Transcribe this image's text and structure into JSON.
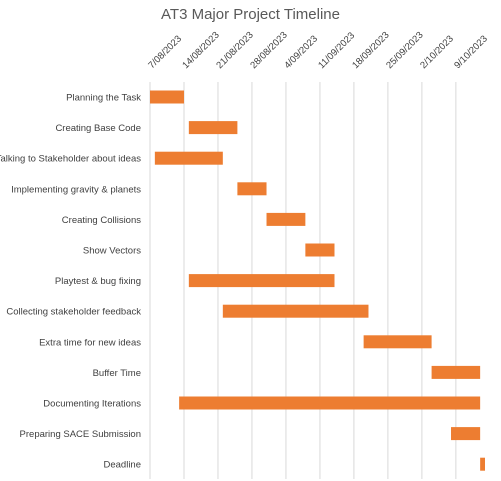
{
  "chart_data": {
    "type": "bar",
    "title": "AT3 Major Project Timeline",
    "x_ticks": [
      "7/08/2023",
      "14/08/2023",
      "21/08/2023",
      "28/08/2023",
      "4/09/2023",
      "11/09/2023",
      "18/09/2023",
      "25/09/2023",
      "2/10/2023",
      "9/10/2023"
    ],
    "xlim": [
      "2023-08-07",
      "2023-10-15"
    ],
    "grid": "vertical",
    "bar_color": "#ED7D31",
    "grid_color": "#D9D9D9",
    "tasks": [
      {
        "name": "Planning the Task",
        "start": "2023-08-07",
        "end": "2023-08-14"
      },
      {
        "name": "Creating Base Code",
        "start": "2023-08-15",
        "end": "2023-08-25"
      },
      {
        "name": "Talking to Stakeholder about ideas",
        "start": "2023-08-08",
        "end": "2023-08-22"
      },
      {
        "name": "Implementing gravity & planets",
        "start": "2023-08-25",
        "end": "2023-08-31"
      },
      {
        "name": "Creating Collisions",
        "start": "2023-08-31",
        "end": "2023-09-08"
      },
      {
        "name": "Show Vectors",
        "start": "2023-09-08",
        "end": "2023-09-14"
      },
      {
        "name": "Playtest & bug fixing",
        "start": "2023-08-15",
        "end": "2023-09-14"
      },
      {
        "name": "Collecting stakeholder feedback",
        "start": "2023-08-22",
        "end": "2023-09-21"
      },
      {
        "name": "Extra time for new ideas",
        "start": "2023-09-20",
        "end": "2023-10-04"
      },
      {
        "name": "Buffer Time",
        "start": "2023-10-04",
        "end": "2023-10-14"
      },
      {
        "name": "Documenting Iterations",
        "start": "2023-08-13",
        "end": "2023-10-14"
      },
      {
        "name": "Preparing SACE Submission",
        "start": "2023-10-08",
        "end": "2023-10-14"
      },
      {
        "name": "Deadline",
        "start": "2023-10-14",
        "end": "2023-10-15"
      }
    ]
  }
}
